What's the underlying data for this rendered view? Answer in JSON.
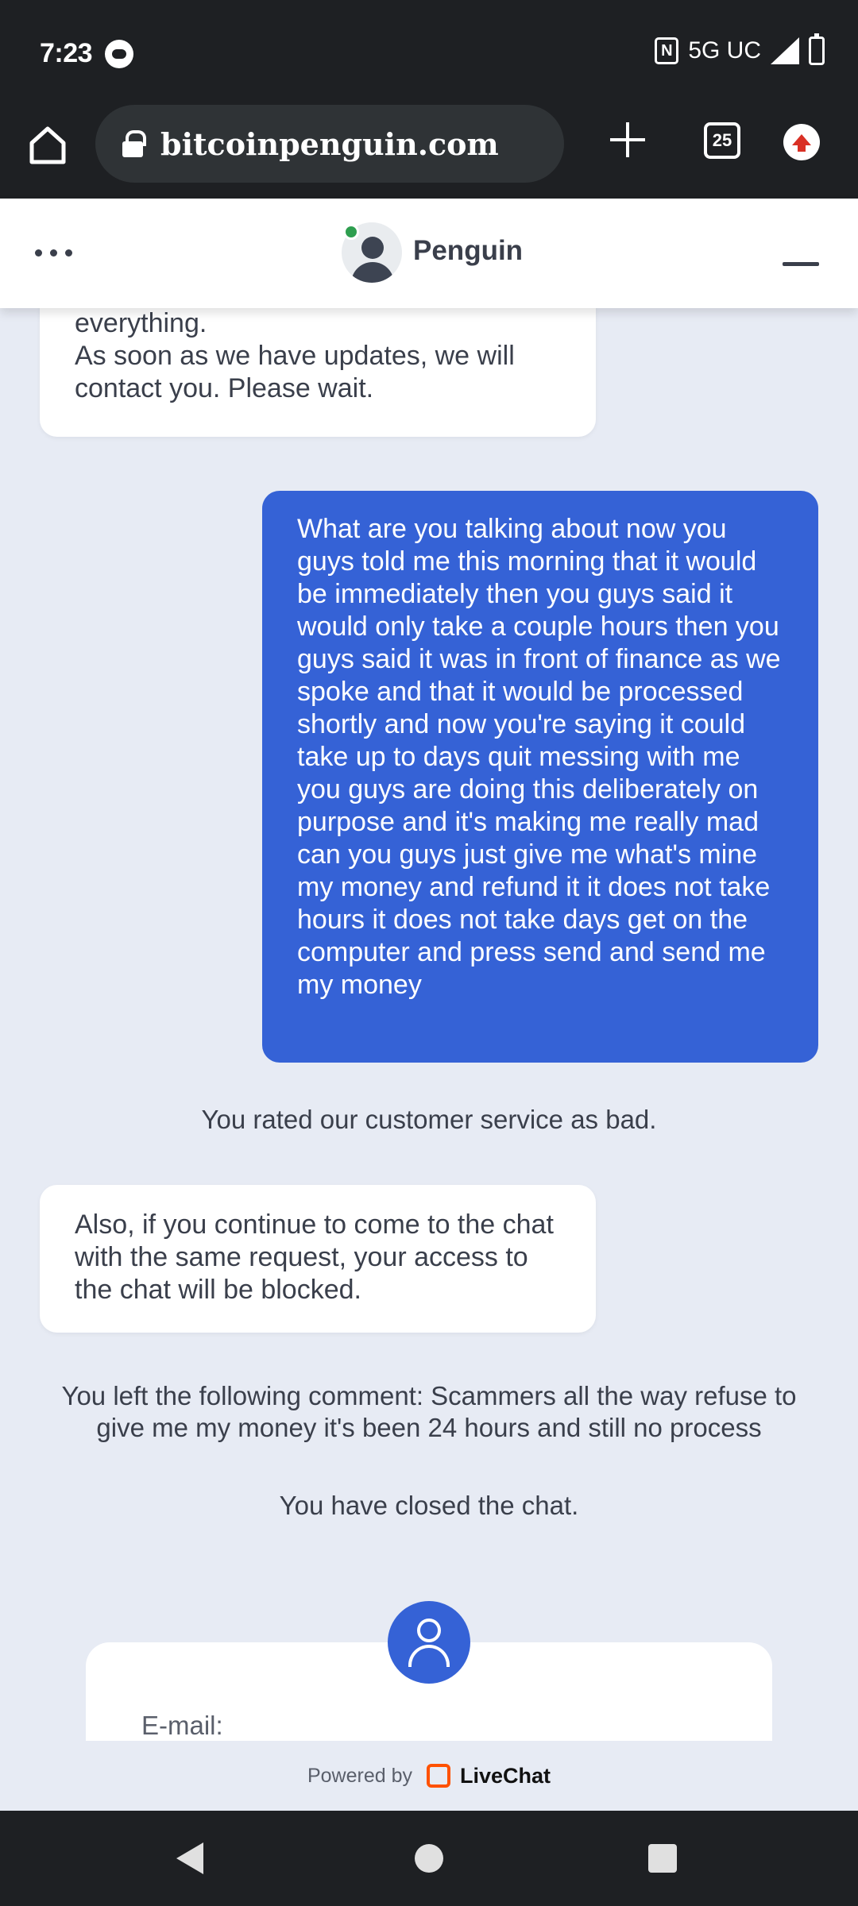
{
  "status_bar": {
    "time": "7:23",
    "network": "5G UC"
  },
  "browser": {
    "url": "bitcoinpenguin.com",
    "tab_count": "25"
  },
  "chat_header": {
    "agent_name": "Penguin"
  },
  "messages": {
    "agent_top": "take several business days to process everything.\nAs soon as we have updates, we will contact you. Please wait.",
    "user": "What are you talking about now you guys told me this morning that it would be immediately then you guys said it would only take a couple hours then you guys said it was in front of finance as we spoke and that it would be processed shortly and now you're saying it could take up to days quit messing with me you guys are doing this deliberately on purpose and it's making me really mad can you guys just give me what's mine my money and refund it it does not take hours it does not take days get on the computer and press send and send me my money",
    "rating_note": "You rated our customer service as bad.",
    "agent_warning": "Also, if you continue to come to the chat with the same request, your access to the chat will be blocked.",
    "comment_note": "You left the following comment: Scammers all the way refuse to give me my money it's been 24 hours and still no process",
    "closed_note": "You have closed the chat."
  },
  "contact_form": {
    "email_label": "E-mail:"
  },
  "footer": {
    "powered_by": "Powered by",
    "brand": "LiveChat"
  },
  "colors": {
    "user_bubble": "#3562d6",
    "chat_background": "#e7ebf4",
    "online": "#2e9e4f",
    "livechat_brand": "#ff5100"
  }
}
